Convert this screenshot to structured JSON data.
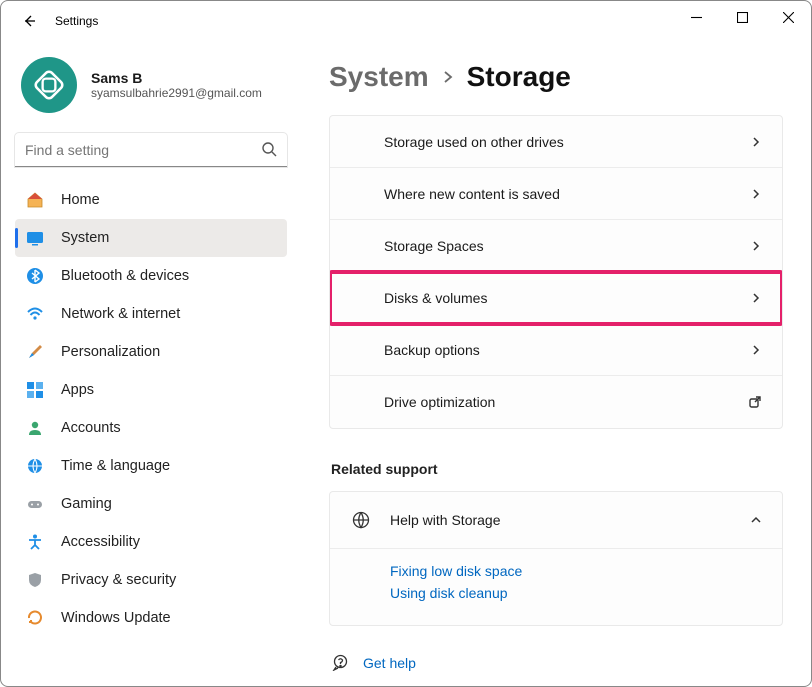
{
  "window": {
    "title": "Settings"
  },
  "profile": {
    "name": "Sams B",
    "email": "syamsulbahrie2991@gmail.com"
  },
  "search": {
    "placeholder": "Find a setting"
  },
  "nav": {
    "items": [
      {
        "id": "home",
        "label": "Home"
      },
      {
        "id": "system",
        "label": "System"
      },
      {
        "id": "bluetooth",
        "label": "Bluetooth & devices"
      },
      {
        "id": "network",
        "label": "Network & internet"
      },
      {
        "id": "personalization",
        "label": "Personalization"
      },
      {
        "id": "apps",
        "label": "Apps"
      },
      {
        "id": "accounts",
        "label": "Accounts"
      },
      {
        "id": "time",
        "label": "Time & language"
      },
      {
        "id": "gaming",
        "label": "Gaming"
      },
      {
        "id": "accessibility",
        "label": "Accessibility"
      },
      {
        "id": "privacy",
        "label": "Privacy & security"
      },
      {
        "id": "update",
        "label": "Windows Update"
      }
    ],
    "active": "system"
  },
  "breadcrumb": {
    "parent": "System",
    "current": "Storage"
  },
  "storage_rows": [
    {
      "id": "other-drives",
      "label": "Storage used on other drives",
      "action": "chevron"
    },
    {
      "id": "where-saved",
      "label": "Where new content is saved",
      "action": "chevron"
    },
    {
      "id": "storage-spaces",
      "label": "Storage Spaces",
      "action": "chevron"
    },
    {
      "id": "disks-volumes",
      "label": "Disks & volumes",
      "action": "chevron",
      "highlight": true
    },
    {
      "id": "backup",
      "label": "Backup options",
      "action": "chevron"
    },
    {
      "id": "drive-opt",
      "label": "Drive optimization",
      "action": "external"
    }
  ],
  "related_support": {
    "heading": "Related support",
    "card_title": "Help with Storage",
    "links": [
      "Fixing low disk space",
      "Using disk cleanup"
    ]
  },
  "get_help": "Get help"
}
